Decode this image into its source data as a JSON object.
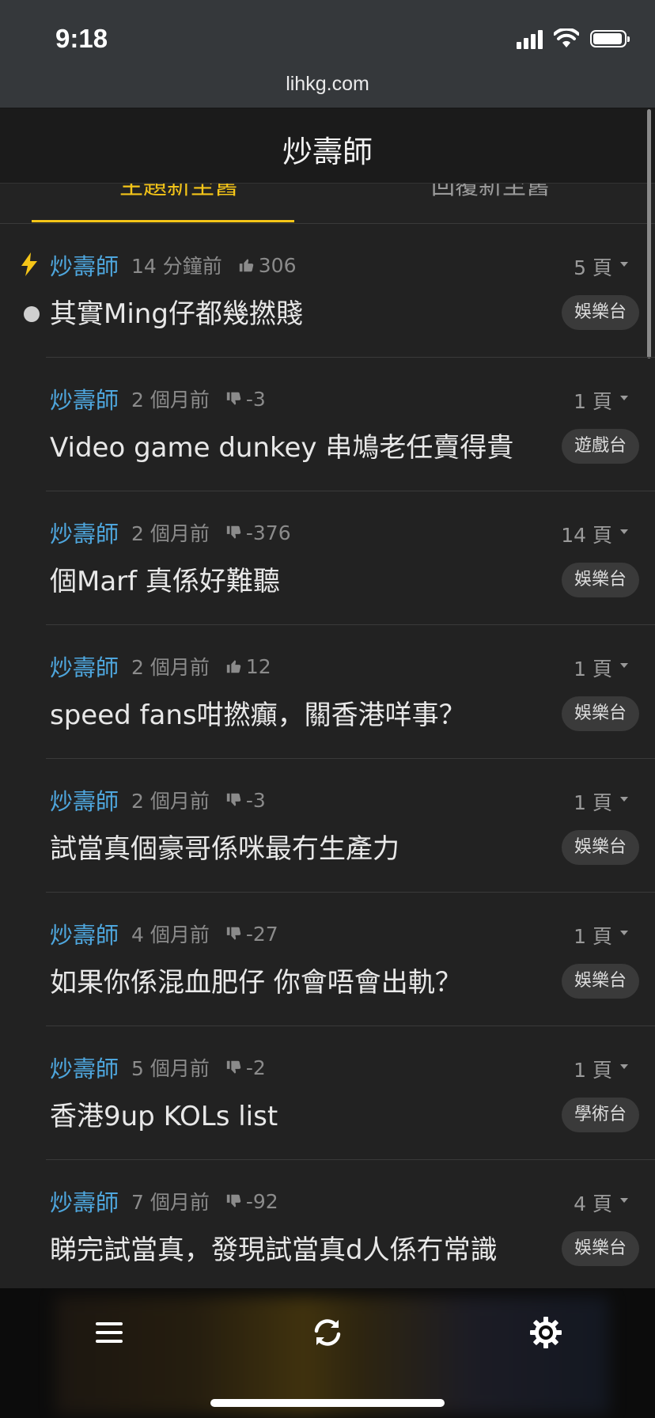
{
  "status_bar": {
    "time": "9:18"
  },
  "browser": {
    "url": "lihkg.com"
  },
  "header": {
    "title": "炒壽師"
  },
  "tabs": [
    {
      "label": "主題新至舊",
      "active": true
    },
    {
      "label": "回覆新至舊",
      "active": false
    }
  ],
  "threads": [
    {
      "author": "炒壽師",
      "time_ago": "14 分鐘前",
      "vote_type": "up",
      "votes": "306",
      "pages": "5 頁",
      "title": "其實Ming仔都幾撚賤",
      "category": "娛樂台",
      "unread": true,
      "hot": true
    },
    {
      "author": "炒壽師",
      "time_ago": "2 個月前",
      "vote_type": "down",
      "votes": "-3",
      "pages": "1 頁",
      "title": "Video game dunkey 串鳩老任賣得貴",
      "category": "遊戲台"
    },
    {
      "author": "炒壽師",
      "time_ago": "2 個月前",
      "vote_type": "down",
      "votes": "-376",
      "pages": "14 頁",
      "title": "個Marf 真係好難聽",
      "category": "娛樂台"
    },
    {
      "author": "炒壽師",
      "time_ago": "2 個月前",
      "vote_type": "up",
      "votes": "12",
      "pages": "1 頁",
      "title": "speed fans咁撚癲，關香港咩事？",
      "category": "娛樂台"
    },
    {
      "author": "炒壽師",
      "time_ago": "2 個月前",
      "vote_type": "down",
      "votes": "-3",
      "pages": "1 頁",
      "title": "試當真個豪哥係咪最冇生產力",
      "category": "娛樂台"
    },
    {
      "author": "炒壽師",
      "time_ago": "4 個月前",
      "vote_type": "down",
      "votes": "-27",
      "pages": "1 頁",
      "title": "如果你係混血肥仔 你會唔會出軌？",
      "category": "娛樂台"
    },
    {
      "author": "炒壽師",
      "time_ago": "5 個月前",
      "vote_type": "down",
      "votes": "-2",
      "pages": "1 頁",
      "title": "香港9up KOLs list",
      "category": "學術台"
    },
    {
      "author": "炒壽師",
      "time_ago": "7 個月前",
      "vote_type": "down",
      "votes": "-92",
      "pages": "4 頁",
      "title": "睇完試當真，發現試當真d人係冇常識",
      "category": "娛樂台"
    }
  ],
  "toolbar": {
    "icons": [
      "menu-icon",
      "refresh-icon",
      "settings-icon"
    ]
  },
  "colors": {
    "accent": "#f5c518",
    "author": "#4ea6dd",
    "background": "#222222"
  }
}
